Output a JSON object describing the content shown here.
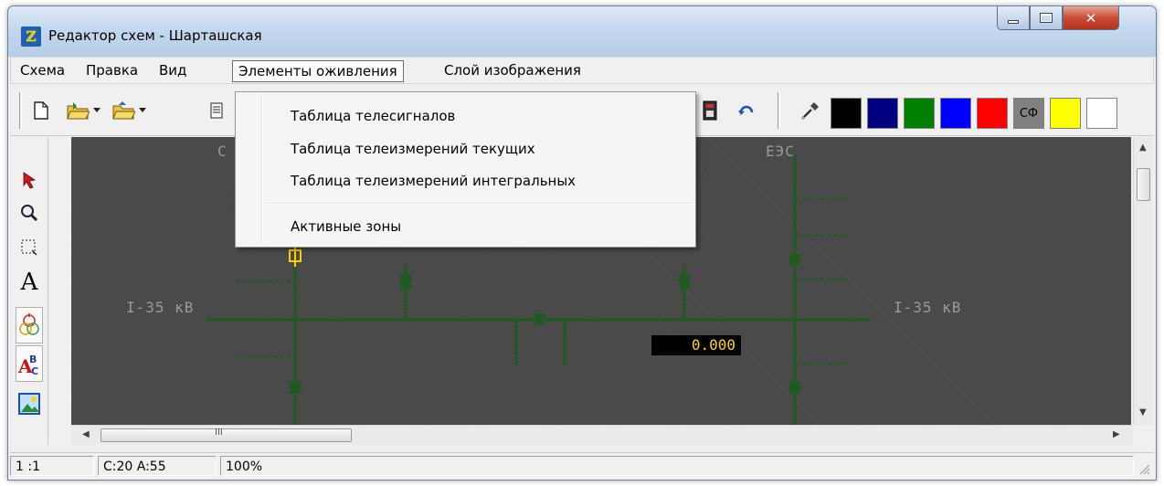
{
  "window": {
    "title": "Редактор схем - Шарташская"
  },
  "menubar": {
    "items": [
      {
        "label": "Схема"
      },
      {
        "label": "Правка"
      },
      {
        "label": "Вид"
      },
      {
        "label": "Элементы оживления"
      },
      {
        "label": "Слой изображения"
      }
    ],
    "active_index": 3
  },
  "dropdown": {
    "items": [
      {
        "label": "Таблица телесигналов"
      },
      {
        "label": "Таблица телеизмерений текущих"
      },
      {
        "label": "Таблица телеизмерений интегральных"
      },
      {
        "label": "Активные зоны"
      }
    ]
  },
  "toolbar": {
    "icons": [
      "new-file-icon",
      "open-folder-icon",
      "save-folder-icon",
      "print-icon",
      "device-icon",
      "refresh-icon",
      "eyedropper-icon"
    ],
    "palette": [
      {
        "color": "#000000",
        "label": ""
      },
      {
        "color": "#000080",
        "label": ""
      },
      {
        "color": "#008000",
        "label": ""
      },
      {
        "color": "#0000ff",
        "label": ""
      },
      {
        "color": "#ff0000",
        "label": ""
      },
      {
        "color": "#808080",
        "label": "СФ"
      },
      {
        "color": "#ffff00",
        "label": ""
      },
      {
        "color": "#ffffff",
        "label": ""
      }
    ]
  },
  "canvas": {
    "value_display": "0.000",
    "bus_label_left": "I-35 кВ",
    "bus_label_right": "I-35 кВ",
    "top_label_left": "C",
    "top_label_right": "ЕЭС"
  },
  "statusbar": {
    "cell1": "1 :1",
    "cell2": "C:20  A:55",
    "cell3": "100%"
  },
  "scroll": {
    "hscroll_mid": "III"
  },
  "colors": {
    "schematic_line": "#1f5a1f",
    "value_text": "#ffd800",
    "canvas_bg": "#474747"
  }
}
